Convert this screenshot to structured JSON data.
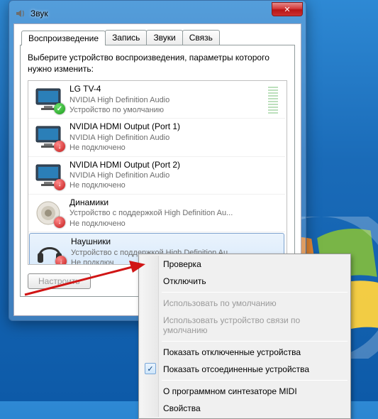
{
  "window": {
    "title": "Звук",
    "close_symbol": "✕"
  },
  "tabs": [
    {
      "label": "Воспроизведение",
      "active": true
    },
    {
      "label": "Запись",
      "active": false
    },
    {
      "label": "Звуки",
      "active": false
    },
    {
      "label": "Связь",
      "active": false
    }
  ],
  "instruction": "Выберите устройство воспроизведения, параметры которого нужно изменить:",
  "devices": [
    {
      "name": "LG TV-4",
      "driver": "NVIDIA High Definition Audio",
      "status": "Устройство по умолчанию",
      "badge": "ok",
      "icon": "monitor",
      "selected": false,
      "meter": true
    },
    {
      "name": "NVIDIA HDMI Output (Port 1)",
      "driver": "NVIDIA High Definition Audio",
      "status": "Не подключено",
      "badge": "down",
      "icon": "monitor",
      "selected": false
    },
    {
      "name": "NVIDIA HDMI Output (Port 2)",
      "driver": "NVIDIA High Definition Audio",
      "status": "Не подключено",
      "badge": "down",
      "icon": "monitor",
      "selected": false
    },
    {
      "name": "Динамики",
      "driver": "Устройство с поддержкой High Definition Au...",
      "status": "Не подключено",
      "badge": "down",
      "icon": "speaker",
      "selected": false
    },
    {
      "name": "Наушники",
      "driver": "Устройство с поддержкой High Definition Au...",
      "status": "Не подключ",
      "badge": "down",
      "icon": "headphones",
      "selected": true
    }
  ],
  "buttons": {
    "configure": "Настроить",
    "properties_hidden": "",
    "ok": "",
    "cancel": "",
    "apply": ""
  },
  "context_menu": [
    {
      "label": "Проверка",
      "type": "item"
    },
    {
      "label": "Отключить",
      "type": "item"
    },
    {
      "type": "sep"
    },
    {
      "label": "Использовать по умолчанию",
      "type": "item",
      "disabled": true
    },
    {
      "label": "Использовать устройство связи по умолчанию",
      "type": "item",
      "disabled": true
    },
    {
      "type": "sep"
    },
    {
      "label": "Показать отключенные устройства",
      "type": "item"
    },
    {
      "label": "Показать отсоединенные устройства",
      "type": "item",
      "checked": true
    },
    {
      "type": "sep"
    },
    {
      "label": "О программном синтезаторе MIDI",
      "type": "item"
    },
    {
      "label": "Свойства",
      "type": "item"
    }
  ]
}
